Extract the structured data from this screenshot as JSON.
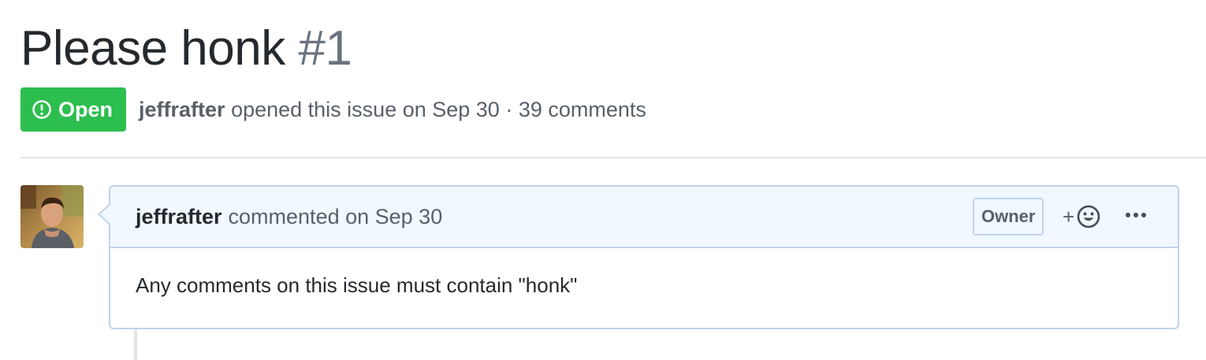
{
  "issue": {
    "title": "Please honk",
    "number": "#1",
    "state": "Open",
    "author": "jeffrafter",
    "opened_text": "opened this issue on Sep 30 · 39 comments"
  },
  "comment": {
    "author": "jeffrafter",
    "action_text": "commented on Sep 30",
    "role_badge": "Owner",
    "reaction_plus": "+",
    "body": "Any comments on this issue must contain \"honk\""
  },
  "icons": {
    "state": "issue-opened-icon",
    "reaction": "smiley-icon",
    "more": "kebab-horizontal-icon"
  },
  "colors": {
    "open_green": "#2cbe4e",
    "header_bg": "#f1f8ff",
    "header_border": "#c0d3eb",
    "muted_text": "#586069"
  }
}
